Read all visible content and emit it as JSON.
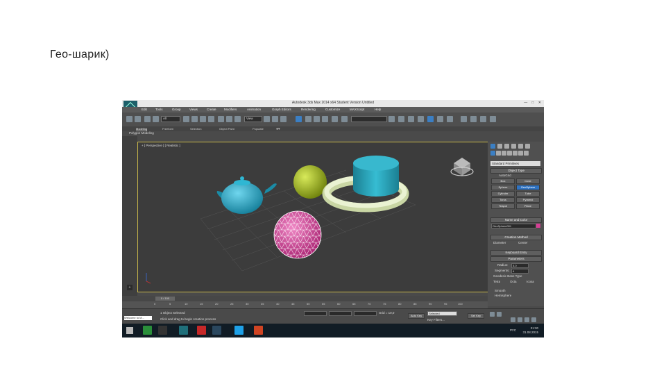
{
  "slide": {
    "title": "Гео-шарик)"
  },
  "app": {
    "window_title": "Autodesk 3ds Max 2014 x64    Student Version    Untitled",
    "window_buttons": [
      "—",
      "□",
      "✕"
    ],
    "menu": [
      "Edit",
      "Tools",
      "Group",
      "Views",
      "Create",
      "Modifiers",
      "Animation",
      "Graph Editors",
      "Rendering",
      "Customize",
      "MAXScript",
      "Help"
    ],
    "toolbar": {
      "selection_filter": "All",
      "ref_coord": "View"
    },
    "ribbon_tabs": [
      "Modeling",
      "Freeform",
      "Selection",
      "Object Paint",
      "Populate"
    ],
    "ribbon_active": "Modeling",
    "subtitle": "Polygon Modeling",
    "viewport": {
      "label": "+ [ Perspective ] [ Realistic ]",
      "colors": {
        "teapot": "#2aa5c4",
        "geosphere": "#d6489b",
        "sphere": "#9fb51f",
        "torus": "#dfe9bf",
        "cylinder": "#2a9fb3",
        "frame": "#c9b84a"
      }
    },
    "command_panel": {
      "dropdown": "Standard Primitives",
      "object_type_header": "Object Type",
      "autogrid": "AutoGrid",
      "primitives": [
        "Box",
        "Cone",
        "Sphere",
        "GeoSphere",
        "Cylinder",
        "Tube",
        "Torus",
        "Pyramid",
        "Teapot",
        "Plane"
      ],
      "selected": "GeoSphere",
      "name_color_header": "Name and Color",
      "object_name": "GeoSphere001",
      "creation_method_header": "Creation Method",
      "creation_options": [
        "Diameter",
        "Center"
      ],
      "keyboard_entry_header": "Keyboard Entry",
      "parameters_header": "Parameters",
      "radius_label": "Radius:",
      "radius_value": "3,0",
      "segments_label": "Segments:",
      "segments_value": "4",
      "base_type_label": "Geodesic Base Type",
      "base_types": [
        "Tetra",
        "Octa",
        "Icosa"
      ],
      "smooth": "Smooth",
      "hemisphere": "Hemisphere"
    },
    "timeline": {
      "frame": "0 / 100",
      "ticks": [
        "0",
        "5",
        "10",
        "15",
        "20",
        "25",
        "30",
        "35",
        "40",
        "45",
        "50",
        "55",
        "60",
        "65",
        "70",
        "75",
        "80",
        "85",
        "90",
        "95",
        "100"
      ]
    },
    "status": {
      "maxscript": "Welcome to M...",
      "line1": "1 Object Selected",
      "line2": "Click and drag to begin creation process",
      "grid": "Grid = 10,0",
      "autokey": "Auto Key",
      "selected": "Selected",
      "setkey": "Set Key",
      "keyfilters": "Key Filters..."
    },
    "taskbar": {
      "time": "21:30",
      "date": "31.08.2015",
      "lang": "РУС",
      "apps": [
        {
          "name": "3ds Max",
          "color": "#1f6f7a"
        },
        {
          "name": "Yandex",
          "color": "#c62828"
        },
        {
          "name": "Steam",
          "color": "#1b2838"
        },
        {
          "name": "Skype",
          "color": "#1ea1e8"
        },
        {
          "name": "PowerPoint",
          "color": "#d04423"
        }
      ]
    }
  }
}
